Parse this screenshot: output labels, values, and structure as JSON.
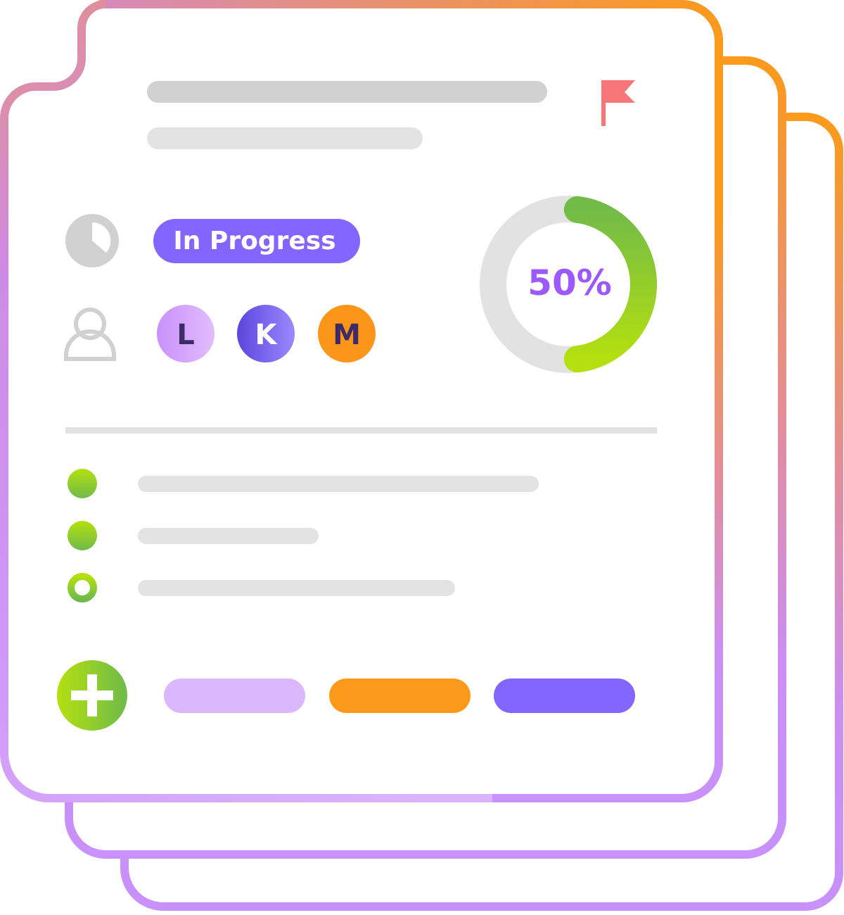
{
  "card": {
    "flag_color": "#f87171",
    "title_placeholder_lines": 2
  },
  "status": {
    "label": "In Progress",
    "badge_color": "#8266ff",
    "icon": "clock-pie-icon"
  },
  "assignees": {
    "icon": "user-icon",
    "avatars": [
      {
        "initial": "L",
        "bg": "#d8a8ff",
        "fg": "#3d2a66"
      },
      {
        "initial": "K",
        "bg": "#6a55e8",
        "fg": "#ffffff"
      },
      {
        "initial": "M",
        "bg": "#fb961a",
        "fg": "#3d2a66"
      }
    ]
  },
  "progress": {
    "value": 50,
    "label": "50%",
    "track_color": "#e2e2e2",
    "fill_from": "#72bb47",
    "fill_to": "#b4e00f",
    "text_color": "#9b59ff"
  },
  "checklist": {
    "items": [
      {
        "done": true
      },
      {
        "done": true
      },
      {
        "done": false
      }
    ]
  },
  "actions": {
    "add_icon": "plus-icon",
    "pills": [
      {
        "name": "light-purple-action",
        "color": "#dbb8fb"
      },
      {
        "name": "orange-action",
        "color": "#fb9a1a"
      },
      {
        "name": "purple-action",
        "color": "#8266ff"
      }
    ]
  }
}
